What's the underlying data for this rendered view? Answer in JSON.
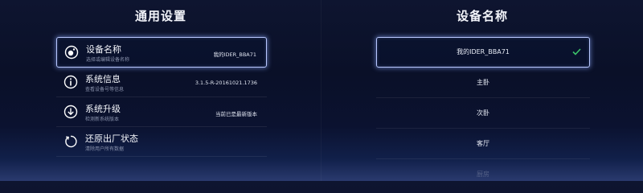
{
  "settings": {
    "title": "通用设置",
    "items": [
      {
        "icon": "device-name-icon",
        "label": "设备名称",
        "sub": "选择或编辑设备名称",
        "value": "我的IDER_BBA71"
      },
      {
        "icon": "info-icon",
        "label": "系统信息",
        "sub": "查看设备号等信息",
        "value": "3.1.5-R-20161021.1736"
      },
      {
        "icon": "upgrade-icon",
        "label": "系统升级",
        "sub": "检测新系统版本",
        "value": "当前已是最新版本"
      },
      {
        "icon": "power-reset-icon",
        "label": "还原出厂状态",
        "sub": "清除用户所有数据",
        "value": ""
      }
    ]
  },
  "device_name": {
    "title": "设备名称",
    "options": [
      "我的IDER_BBA71",
      "主卧",
      "次卧",
      "客厅",
      "厨房"
    ],
    "selected": "我的IDER_BBA71"
  },
  "colors": {
    "focus_border": "#b9c8ff",
    "check": "#3cc46a"
  }
}
